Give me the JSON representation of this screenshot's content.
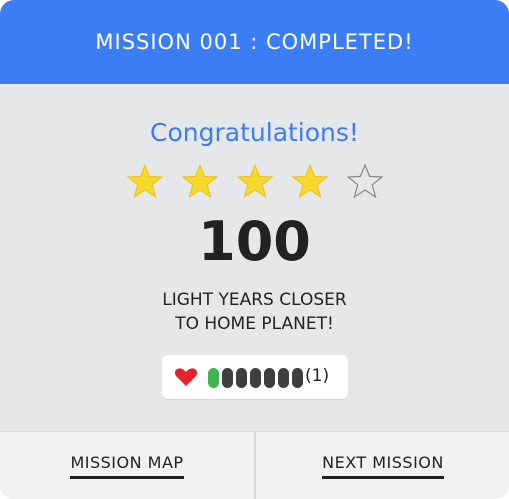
{
  "header": {
    "title": "MISSION 001 : COMPLETED!"
  },
  "result": {
    "congrats": "Congratulations!",
    "stars_earned": 4,
    "stars_total": 5,
    "score": "100",
    "message_line1": "LIGHT YEARS CLOSER",
    "message_line2": "TO HOME PLANET!"
  },
  "health": {
    "icon": "heart-icon",
    "segments_total": 7,
    "segments_filled": 1,
    "lives_text": "(1)"
  },
  "footer": {
    "map_label": "MISSION MAP",
    "next_label": "NEXT MISSION"
  },
  "colors": {
    "header_bg": "#3b7df2",
    "title_blue": "#3b7df2",
    "star_fill": "#f7d82c",
    "heart": "#e8212b",
    "bar_active": "#3fb34f",
    "bar_inactive": "#3d3e40"
  }
}
